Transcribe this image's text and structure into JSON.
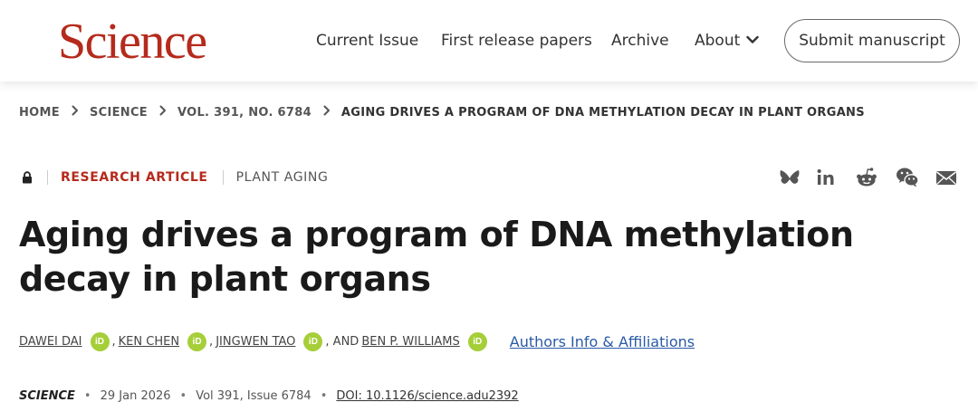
{
  "header": {
    "logo": "Science",
    "nav": {
      "current_issue": "Current Issue",
      "first_release": "First release papers",
      "archive": "Archive",
      "about": "About"
    },
    "submit": "Submit manuscript"
  },
  "breadcrumb": {
    "home": "HOME",
    "science": "SCIENCE",
    "volume": "VOL. 391, NO. 6784",
    "current": "AGING DRIVES A PROGRAM OF DNA METHYLATION DECAY IN PLANT ORGANS"
  },
  "article": {
    "type": "RESEARCH ARTICLE",
    "subject": "PLANT AGING",
    "title": "Aging drives a program of DNA methylation decay in plant organs",
    "authors": [
      {
        "name": "DAWEI DAI"
      },
      {
        "name": "KEN CHEN"
      },
      {
        "name": "JINGWEN TAO"
      },
      {
        "name": "BEN P. WILLIAMS"
      }
    ],
    "author_separators": [
      ",",
      ",",
      ", AND"
    ],
    "orcid_label": "iD",
    "affiliations_link": "Authors Info & Affiliations",
    "citation": {
      "journal": "SCIENCE",
      "date": "29 Jan 2026",
      "volume_issue": "Vol 391, Issue 6784",
      "doi": "DOI: 10.1126/science.adu2392",
      "separator": "•"
    }
  },
  "share_icons": [
    "bluesky-icon",
    "linkedin-icon",
    "reddit-icon",
    "wechat-icon",
    "email-icon"
  ],
  "colors": {
    "brand": "#b52a1c",
    "link": "#2a5aa6",
    "orcid": "#a6ce39"
  }
}
